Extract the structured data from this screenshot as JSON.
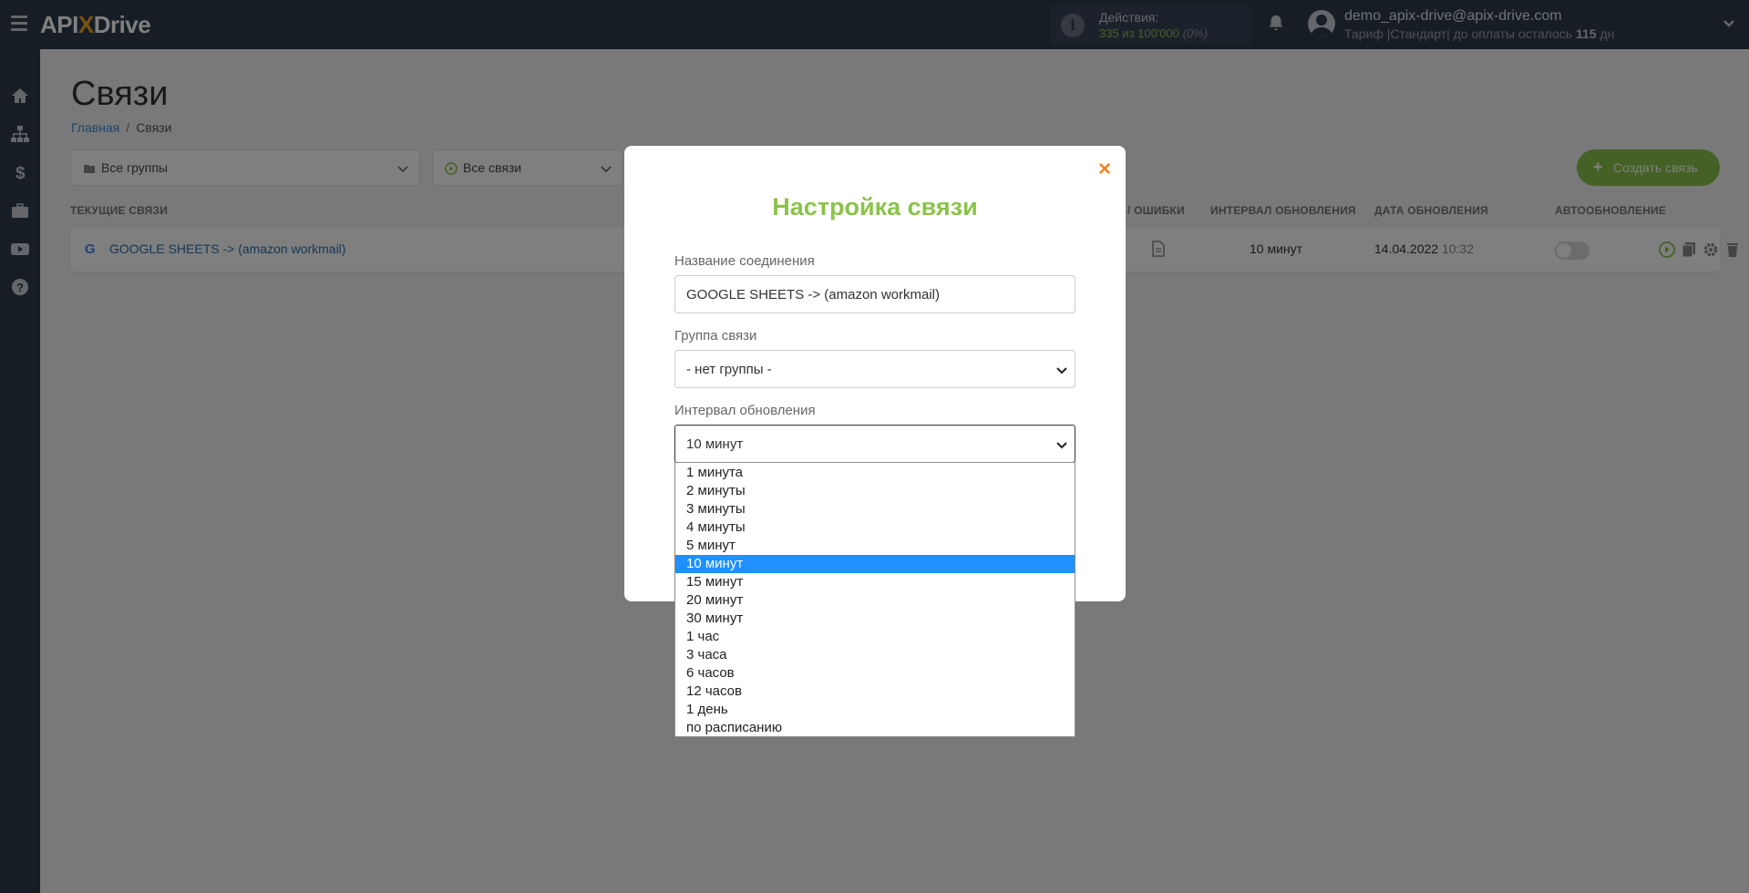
{
  "header": {
    "logo_prefix": "API",
    "logo_x": "X",
    "logo_suffix": "Drive",
    "actions_label": "Действия:",
    "actions_value": "335 из 100'000",
    "actions_percent": "(0%)",
    "user_email": "demo_apix-drive@apix-drive.com",
    "tariff_text": "Тариф |Стандарт| до оплаты осталось",
    "tariff_days": "115",
    "tariff_unit": "дн"
  },
  "page": {
    "title": "Связи",
    "breadcrumb_home": "Главная",
    "breadcrumb_sep": "/",
    "breadcrumb_current": "Связи",
    "filter_groups": "Все группы",
    "filter_links": "Все связи",
    "create_button": "Создать связь"
  },
  "table": {
    "headers": {
      "current": "ТЕКУЩИЕ СВЯЗИ",
      "errors": "/ ОШИБКИ",
      "interval": "ИНТЕРВАЛ ОБНОВЛЕНИЯ",
      "date": "ДАТА ОБНОВЛЕНИЯ",
      "auto": "АВТООБНОВЛЕНИЕ"
    },
    "row": {
      "icon_letter": "G",
      "name": "GOOGLE SHEETS -> (amazon workmail)",
      "interval": "10 минут",
      "date": "14.04.2022",
      "time": "10:32"
    }
  },
  "modal": {
    "close": "×",
    "title": "Настройка связи",
    "name_label": "Название соединения",
    "name_value": "GOOGLE SHEETS -> (amazon workmail)",
    "group_label": "Группа связи",
    "group_value": "- нет группы -",
    "interval_label": "Интервал обновления",
    "interval_value": "10 минут"
  },
  "dropdown": {
    "options": [
      "1 минута",
      "2 минуты",
      "3 минуты",
      "4 минуты",
      "5 минут",
      "10 минут",
      "15 минут",
      "20 минут",
      "30 минут",
      "1 час",
      "3 часа",
      "6 часов",
      "12 часов",
      "1 день",
      "по расписанию"
    ],
    "selected_index": 5
  },
  "colors": {
    "accent_green": "#8bc34a",
    "close_orange": "#f5821f",
    "selected_blue": "#1e90ff",
    "sidebar": "#2d3a4b"
  }
}
